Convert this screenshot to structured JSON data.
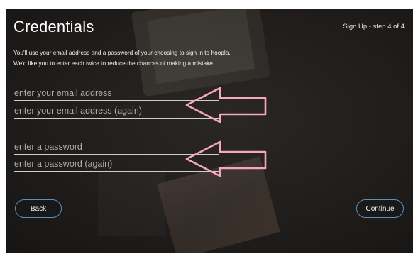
{
  "header": {
    "title": "Credentials",
    "step": "Sign Up - step 4 of 4"
  },
  "description": {
    "line1": "You'll use your email address and a password of your choosing to sign in to hoopla.",
    "line2": "We'd like you to enter each twice to reduce the chances of making a mistake."
  },
  "form": {
    "email_placeholder": "enter your email address",
    "email_confirm_placeholder": "enter your email address (again)",
    "password_placeholder": "enter a password",
    "password_confirm_placeholder": "enter a password (again)",
    "email_value": "",
    "email_confirm_value": "",
    "password_value": "",
    "password_confirm_value": ""
  },
  "buttons": {
    "back": "Back",
    "continue": "Continue"
  },
  "colors": {
    "button_border": "#5f8fb8",
    "annotation_arrow": "#f4a6c3",
    "overlay": "#24211f"
  },
  "icons": {
    "annotation_arrow_email": "left-arrow-icon",
    "annotation_arrow_password": "left-arrow-icon"
  }
}
